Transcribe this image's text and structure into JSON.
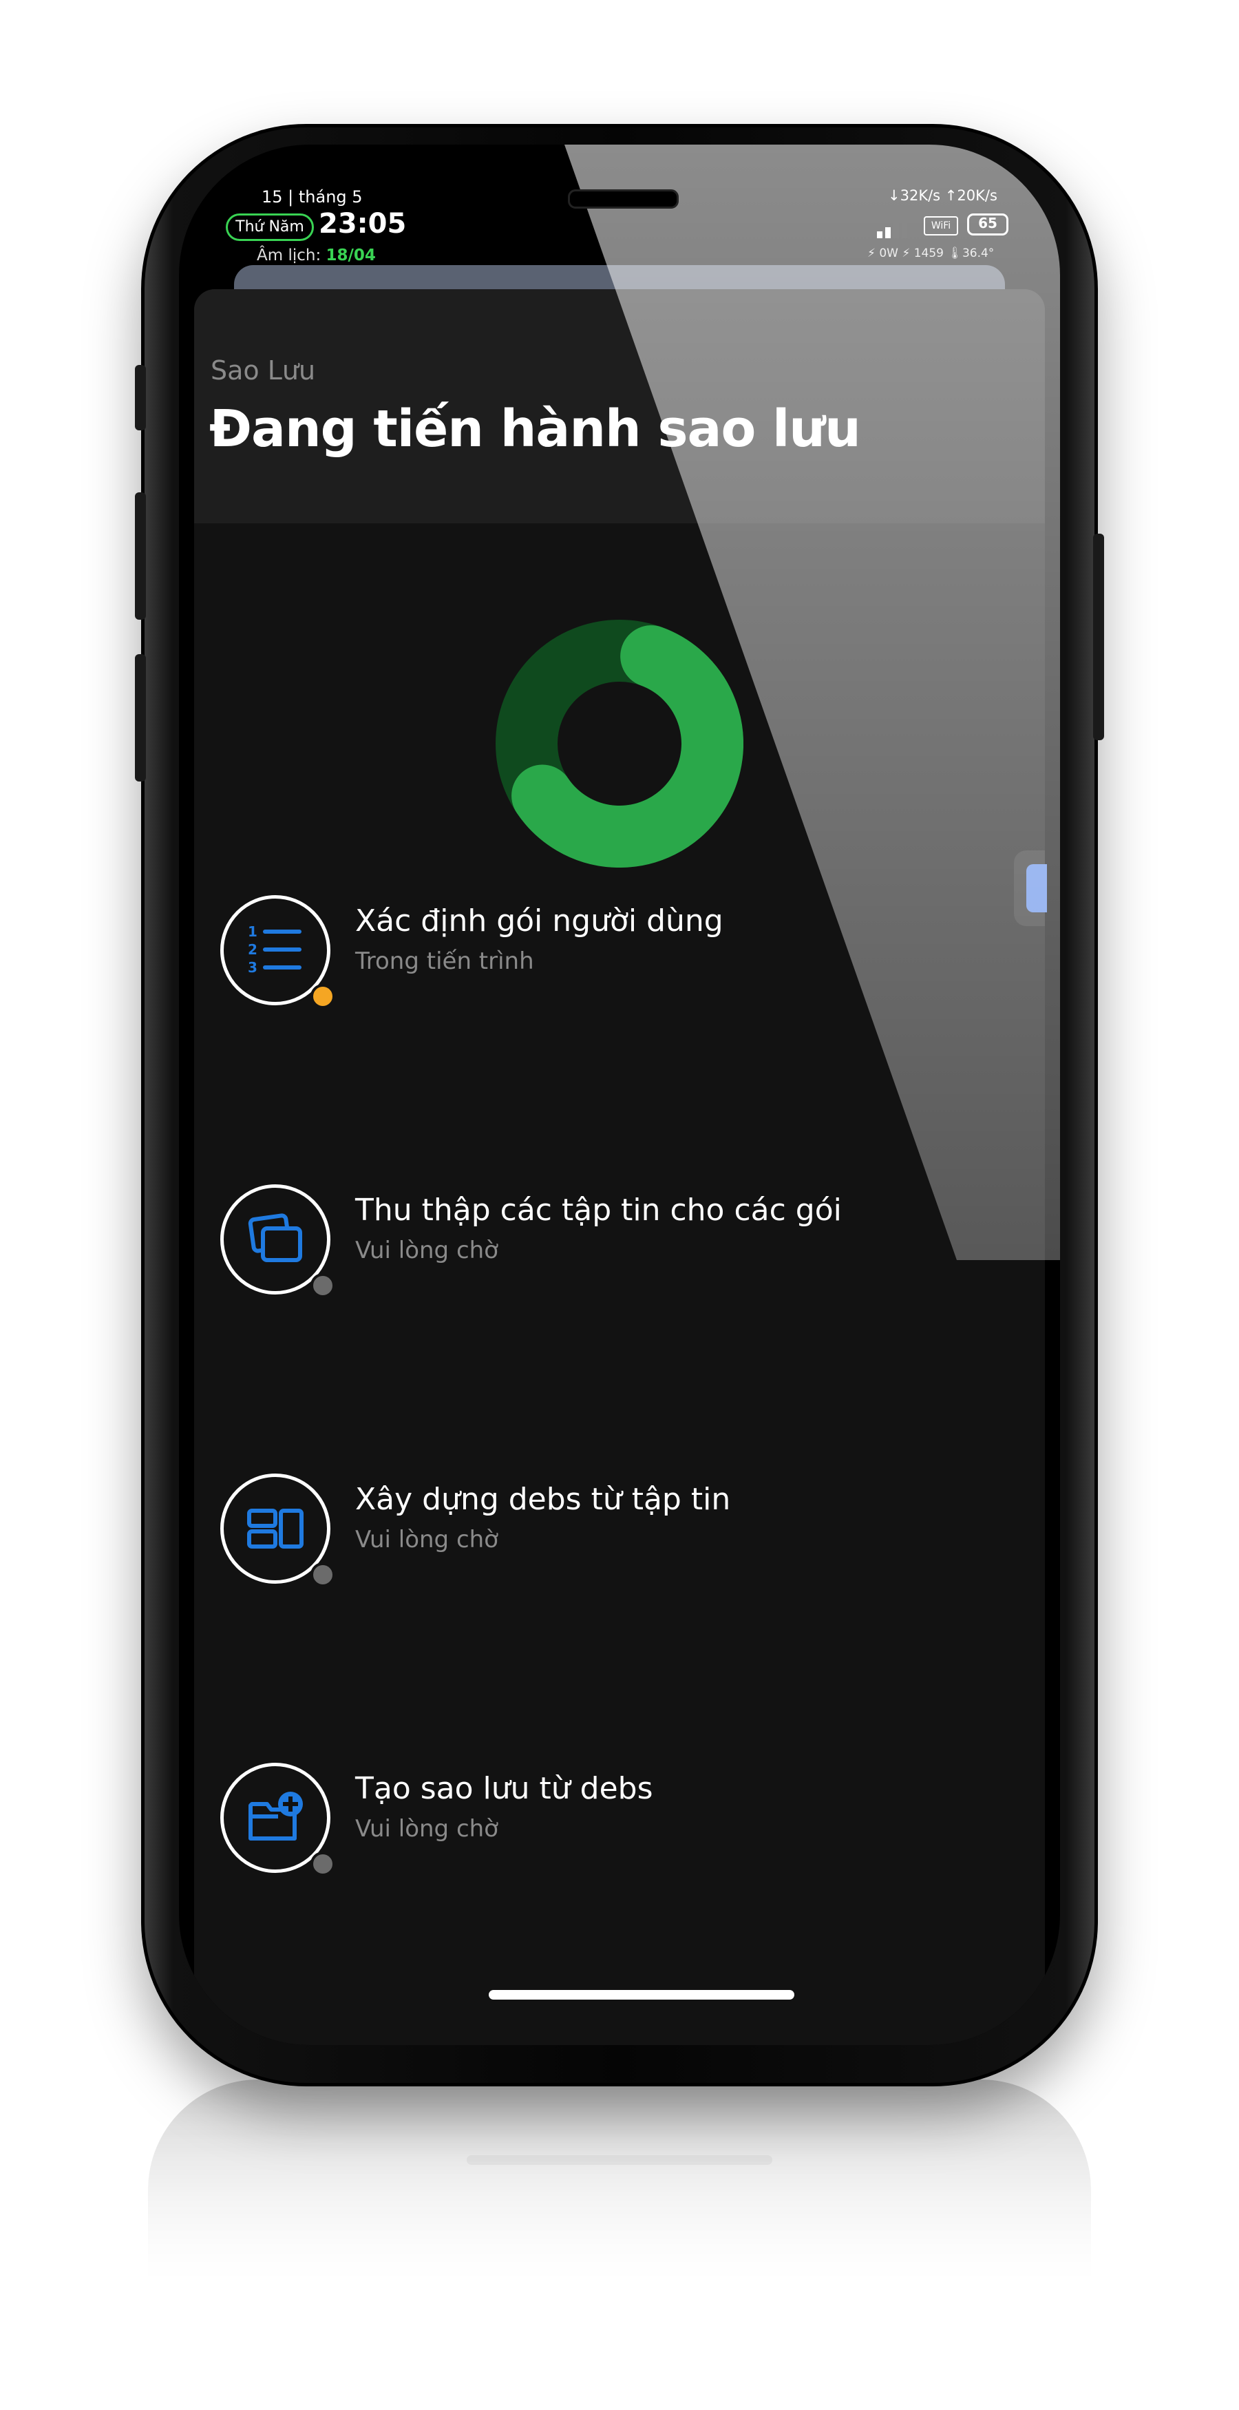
{
  "status_bar": {
    "date_line": "15 | tháng 5",
    "weekday": "Thứ Năm",
    "time": "23:05",
    "lunar_label": "Âm lịch:",
    "lunar_value": "18/04",
    "network_speed": "↓32K/s ↑20K/s",
    "wifi_label": "WiFi",
    "battery_level": "65",
    "stats": "⚡ 0W  ⚡ 1459  🌡36.4°"
  },
  "header": {
    "subtitle": "Sao Lưu",
    "title": "Đang tiến hành sao lưu"
  },
  "progress": {
    "fraction": 0.6,
    "colors": {
      "track": "#0f4a1e",
      "fill": "#2aa84a",
      "center": "#121212"
    }
  },
  "steps": [
    {
      "icon": "numbered-list-icon",
      "title": "Xác định gói người dùng",
      "status": "Trong tiến trình",
      "status_color": "#f5a623"
    },
    {
      "icon": "stacked-cards-icon",
      "title": "Thu thập các tập tin cho các gói",
      "status": "Vui lòng chờ",
      "status_color": "#6b6b6b"
    },
    {
      "icon": "layout-blocks-icon",
      "title": "Xây dựng debs từ tập tin",
      "status": "Vui lòng chờ",
      "status_color": "#6b6b6b"
    },
    {
      "icon": "folder-add-icon",
      "title": "Tạo sao lưu từ debs",
      "status": "Vui lòng chờ",
      "status_color": "#6b6b6b"
    }
  ],
  "colors": {
    "accent_blue": "#1f7ae0",
    "accent_green": "#39d353",
    "background": "#121212",
    "header_bg": "#1e1e1e"
  }
}
